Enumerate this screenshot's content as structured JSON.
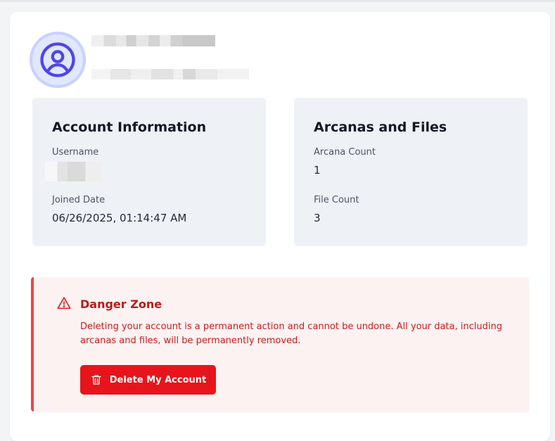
{
  "profile": {
    "avatar_icon": "user-circle-icon",
    "name_redacted": true,
    "email_redacted": true
  },
  "account_info": {
    "title": "Account Information",
    "username_label": "Username",
    "username_redacted": true,
    "joined_label": "Joined Date",
    "joined_value": "06/26/2025, 01:14:47 AM"
  },
  "arcanas_files": {
    "title": "Arcanas and Files",
    "arcana_count_label": "Arcana Count",
    "arcana_count_value": "1",
    "file_count_label": "File Count",
    "file_count_value": "3"
  },
  "danger_zone": {
    "icon": "warning-triangle-icon",
    "title": "Danger Zone",
    "description": "Deleting your account is a permanent action and cannot be undone. All your data, including arcanas and files, will be permanently removed.",
    "delete_button_icon": "trash-icon",
    "delete_button_label": "Delete My Account"
  },
  "colors": {
    "accent": "#4f46e5",
    "danger": "#e7141b",
    "danger_text": "#c81e1e",
    "panel_bg": "#eef1f6"
  }
}
